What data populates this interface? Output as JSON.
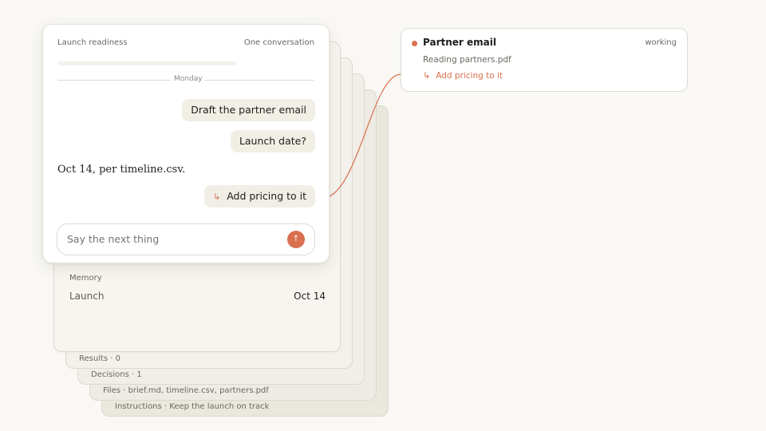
{
  "main_card": {
    "title": "Launch readiness",
    "subtitle": "One conversation",
    "day_divider": "Monday",
    "messages": [
      {
        "role": "user",
        "text": "Draft the partner email"
      },
      {
        "role": "user",
        "text": "Launch date?"
      },
      {
        "role": "assistant",
        "text": "Oct 14, per timeline.csv."
      },
      {
        "role": "user",
        "text": "Add pricing to it",
        "icon": "reply-arrow-icon"
      }
    ],
    "composer": {
      "placeholder": "Say the next thing",
      "value": ""
    }
  },
  "memory": {
    "title": "Memory",
    "key": "Launch",
    "value": "Oct 14"
  },
  "stack_layers": [
    "Results · 0",
    "Decisions · 1",
    "Files · brief.md, timeline.csv, partners.pdf",
    "Instructions · Keep the launch on track"
  ],
  "agent_card": {
    "title": "Partner email",
    "status": "working",
    "reading": "Reading partners.pdf",
    "task": "Add pricing to it",
    "accent": "#d9704f"
  },
  "colors": {
    "background": "#f9f8f4",
    "accent": "#d9704f",
    "bubble": "#f1eee6"
  }
}
